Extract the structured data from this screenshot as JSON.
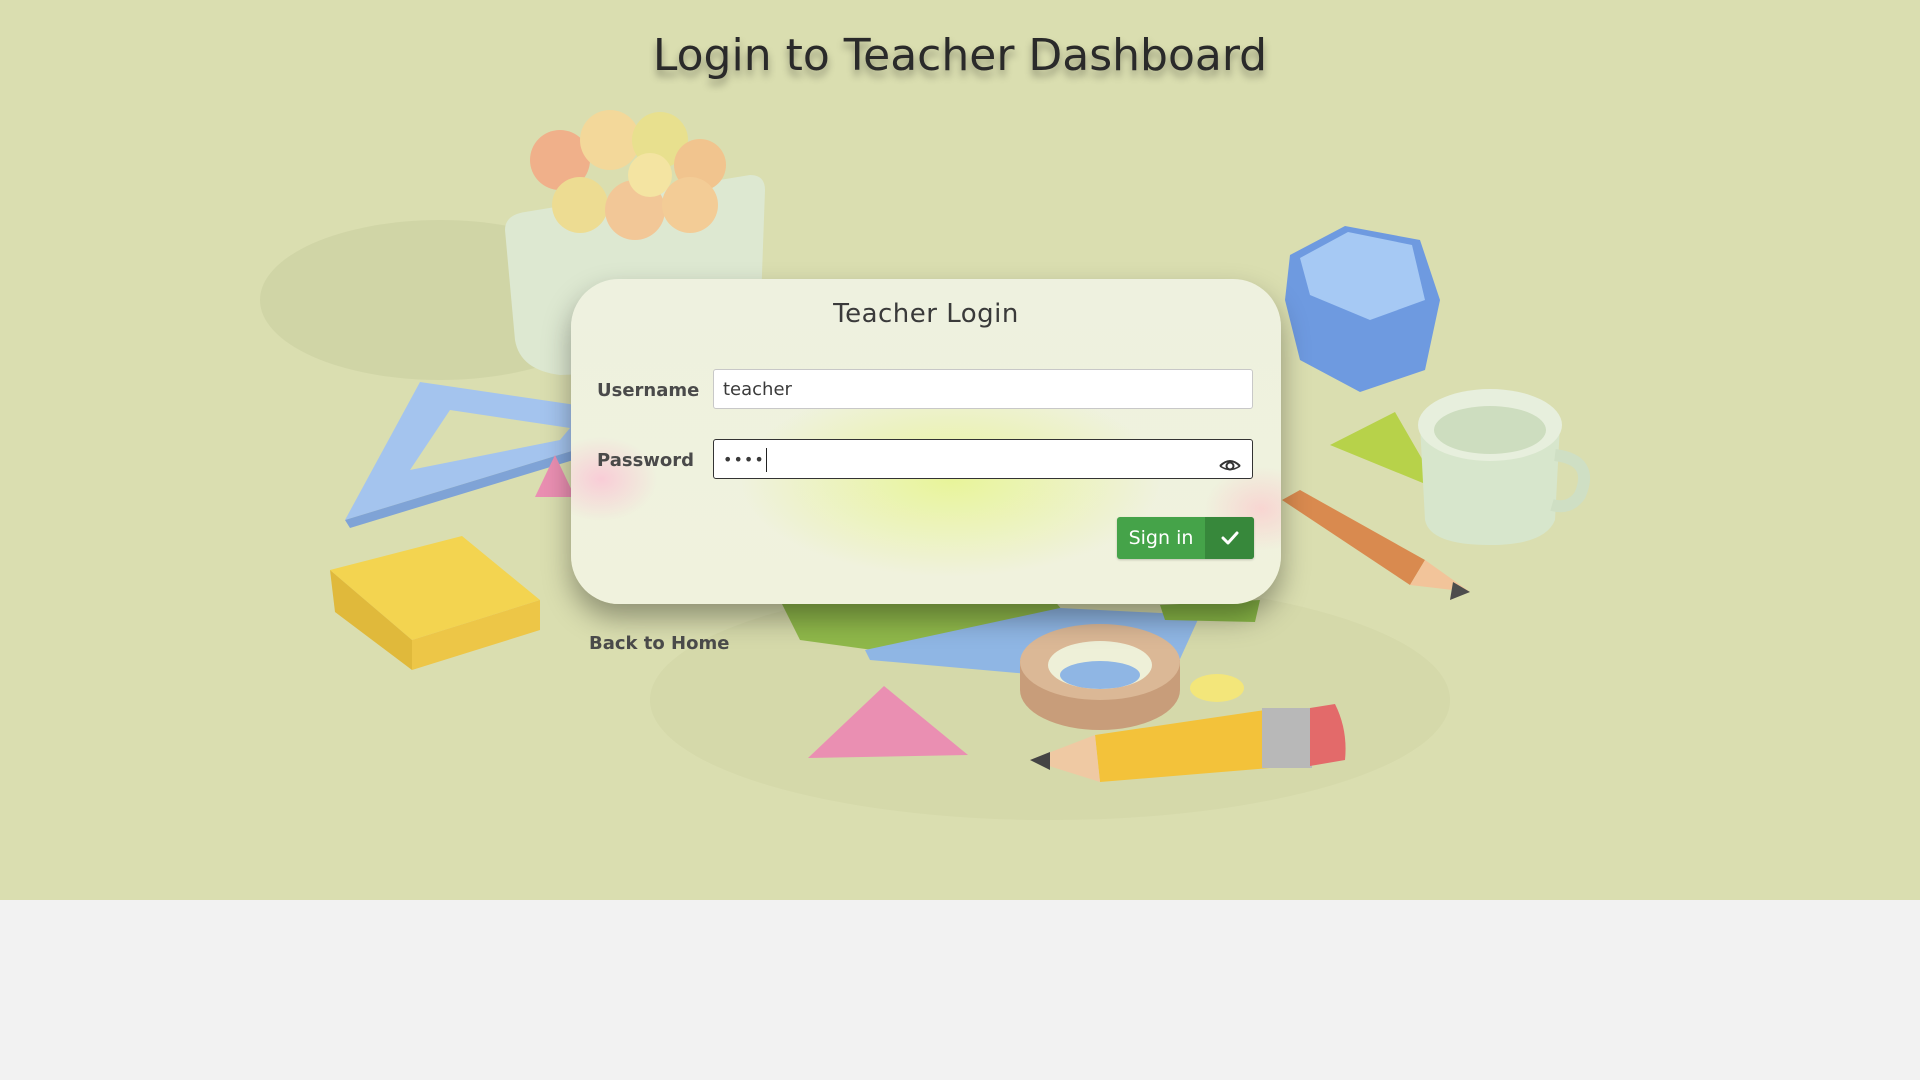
{
  "page": {
    "title": "Login to Teacher Dashboard"
  },
  "login_card": {
    "title": "Teacher Login",
    "username_label": "Username",
    "username_value": "teacher",
    "password_label": "Password",
    "password_masked": "••••",
    "password_toggle_icon": "eye-icon",
    "sign_in_label": "Sign in",
    "sign_in_icon": "checkmark-icon"
  },
  "footer_link": {
    "back_home": "Back to Home"
  },
  "colors": {
    "background": "#dadeb0",
    "lower_background": "#f2f2f2",
    "primary_button": "#45a349",
    "primary_button_icon_bg": "#37883b"
  }
}
